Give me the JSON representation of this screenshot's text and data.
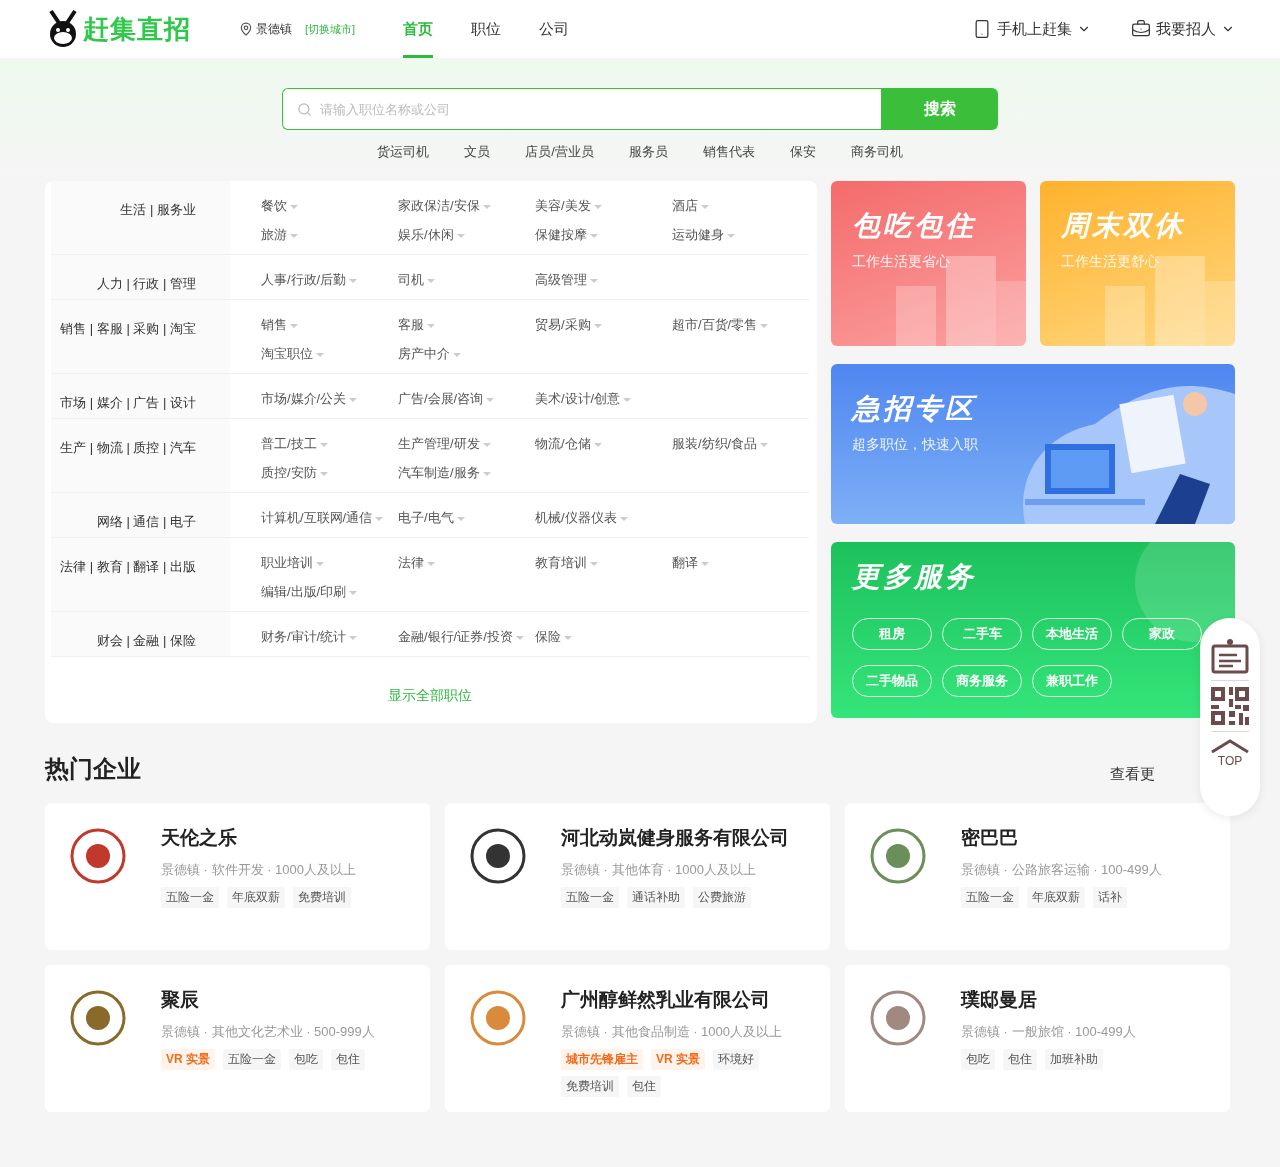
{
  "header": {
    "logo": "赶集直招",
    "city": "景德镇",
    "switch_city": "[切换城市]",
    "nav": [
      {
        "label": "首页",
        "selected": true
      },
      {
        "label": "职位",
        "selected": false
      },
      {
        "label": "公司",
        "selected": false
      }
    ],
    "menus": [
      {
        "kind": "phone",
        "label": "手机上赶集"
      },
      {
        "kind": "bag",
        "label": "我要招人"
      }
    ]
  },
  "search": {
    "placeholder": "请输入职位名称或公司",
    "button": "搜索",
    "hot": [
      "货运司机",
      "文员",
      "店员/营业员",
      "服务员",
      "销售代表",
      "保安",
      "商务司机"
    ]
  },
  "categories": {
    "rows": [
      {
        "title": "生活 | 服务业",
        "items": [
          "餐饮",
          "家政保洁/安保",
          "美容/美发",
          "酒店",
          "旅游",
          "娱乐/休闲",
          "保健按摩",
          "运动健身"
        ]
      },
      {
        "title": "人力 | 行政 | 管理",
        "items": [
          "人事/行政/后勤",
          "司机",
          "高级管理"
        ]
      },
      {
        "title": "销售 | 客服 | 采购 | 淘宝",
        "items": [
          "销售",
          "客服",
          "贸易/采购",
          "超市/百货/零售",
          "淘宝职位",
          "房产中介"
        ]
      },
      {
        "title": "市场 | 媒介 | 广告 | 设计",
        "items": [
          "市场/媒介/公关",
          "广告/会展/咨询",
          "美术/设计/创意"
        ]
      },
      {
        "title": "生产 | 物流 | 质控 | 汽车",
        "items": [
          "普工/技工",
          "生产管理/研发",
          "物流/仓储",
          "服装/纺织/食品",
          "质控/安防",
          "汽车制造/服务"
        ]
      },
      {
        "title": "网络 | 通信 | 电子",
        "items": [
          "计算机/互联网/通信",
          "电子/电气",
          "机械/仪器仪表"
        ]
      },
      {
        "title": "法律 | 教育 | 翻译 | 出版",
        "items": [
          "职业培训",
          "法律",
          "教育培训",
          "翻译",
          "编辑/出版/印刷"
        ]
      },
      {
        "title": "财会 | 金融 | 保险",
        "items": [
          "财务/审计/统计",
          "金融/银行/证券/投资",
          "保险"
        ]
      }
    ],
    "show_all": "显示全部职位"
  },
  "promos": [
    {
      "kind": "red",
      "title": "包吃包住",
      "subtitle": "工作生活更省心"
    },
    {
      "kind": "orange",
      "title": "周末双休",
      "subtitle": "工作生活更舒心"
    }
  ],
  "urgent": {
    "title": "急招专区",
    "subtitle": "超多职位，快速入职"
  },
  "services": {
    "title": "更多服务",
    "items": [
      "租房",
      "二手车",
      "本地生活",
      "家政",
      "二手物品",
      "商务服务",
      "兼职工作"
    ]
  },
  "hot_companies": {
    "title": "热门企业",
    "more": "查看更",
    "companies": [
      {
        "name": "天伦之乐",
        "meta": "景德镇 · 软件开发 · 1000人及以上",
        "tags": [
          {
            "kind": "plain",
            "label": "五险一金"
          },
          {
            "kind": "plain",
            "label": "年底双薪"
          },
          {
            "kind": "plain",
            "label": "免费培训"
          }
        ]
      },
      {
        "name": "河北动岚健身服务有限公司",
        "meta": "景德镇 · 其他体育 · 1000人及以上",
        "tags": [
          {
            "kind": "plain",
            "label": "五险一金"
          },
          {
            "kind": "plain",
            "label": "通话补助"
          },
          {
            "kind": "plain",
            "label": "公费旅游"
          }
        ]
      },
      {
        "name": "密巴巴",
        "meta": "景德镇 · 公路旅客运输 · 100-499人",
        "tags": [
          {
            "kind": "plain",
            "label": "五险一金"
          },
          {
            "kind": "plain",
            "label": "年底双薪"
          },
          {
            "kind": "plain",
            "label": "话补"
          }
        ]
      },
      {
        "name": "聚辰",
        "meta": "景德镇 · 其他文化艺术业 · 500-999人",
        "tags": [
          {
            "kind": "vr",
            "label": "VR 实景"
          },
          {
            "kind": "plain",
            "label": "五险一金"
          },
          {
            "kind": "plain",
            "label": "包吃"
          },
          {
            "kind": "plain",
            "label": "包住"
          }
        ]
      },
      {
        "name": "广州醇鲜然乳业有限公司",
        "meta": "景德镇 · 其他食品制造 · 1000人及以上",
        "tags": [
          {
            "kind": "pioneer",
            "label": "城市先锋雇主"
          },
          {
            "kind": "vr",
            "label": "VR 实景"
          },
          {
            "kind": "plain",
            "label": "环境好"
          },
          {
            "kind": "plain",
            "label": "免费培训"
          },
          {
            "kind": "plain",
            "label": "包住"
          }
        ]
      },
      {
        "name": "璞邸曼居",
        "meta": "景德镇 · 一般旅馆 · 100-499人",
        "tags": [
          {
            "kind": "plain",
            "label": "包吃"
          },
          {
            "kind": "plain",
            "label": "包住"
          },
          {
            "kind": "plain",
            "label": "加班补助"
          }
        ]
      }
    ]
  },
  "float_bar": {
    "top": "TOP"
  }
}
